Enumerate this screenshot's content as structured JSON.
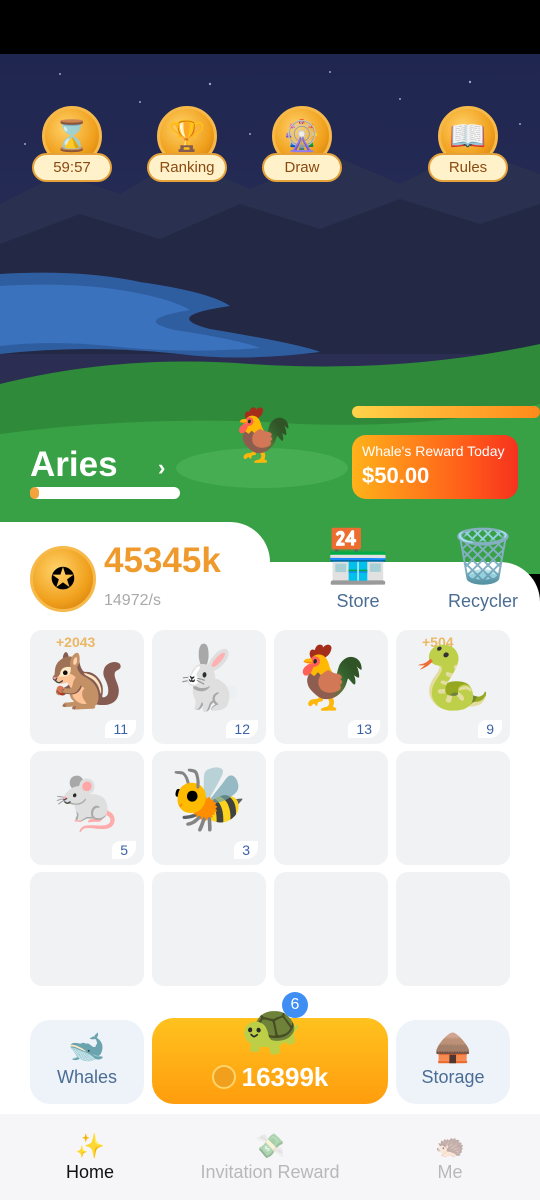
{
  "top_buttons": [
    {
      "label": "59:57",
      "icon": "hourglass-coin-icon"
    },
    {
      "label": "Ranking",
      "icon": "trophy-icon"
    },
    {
      "label": "Draw",
      "icon": "wheel-icon"
    },
    {
      "label": "Rules",
      "icon": "book-icon"
    }
  ],
  "sign": {
    "name": "Aries",
    "progress": 0.06
  },
  "reward": {
    "title": "Whale's Reward Today",
    "value": "$50.00"
  },
  "wallet": {
    "coins": "45345k",
    "rate": "14972/s"
  },
  "tools": {
    "store": "Store",
    "recycler": "Recycler"
  },
  "cells": [
    {
      "animal": "chipmunk",
      "emoji": "🐿️",
      "level": "11",
      "bonus": "+2043"
    },
    {
      "animal": "rabbit",
      "emoji": "🐇",
      "level": "12",
      "bonus": ""
    },
    {
      "animal": "rooster",
      "emoji": "🐓",
      "level": "13",
      "bonus": ""
    },
    {
      "animal": "snake",
      "emoji": "🐍",
      "level": "9",
      "bonus": "+504"
    },
    {
      "animal": "mouse",
      "emoji": "🐁",
      "level": "5",
      "bonus": ""
    },
    {
      "animal": "bee",
      "emoji": "🐝",
      "level": "3",
      "bonus": ""
    }
  ],
  "actions": {
    "whales": "Whales",
    "storage": "Storage",
    "buy_price": "16399k",
    "buy_badge": "6"
  },
  "nav": {
    "home": "Home",
    "invite": "Invitation Reward",
    "me": "Me"
  },
  "colors": {
    "accent": "#ef9a2c",
    "nav_active": "#111111",
    "nav_inactive": "#b8b8b8"
  }
}
